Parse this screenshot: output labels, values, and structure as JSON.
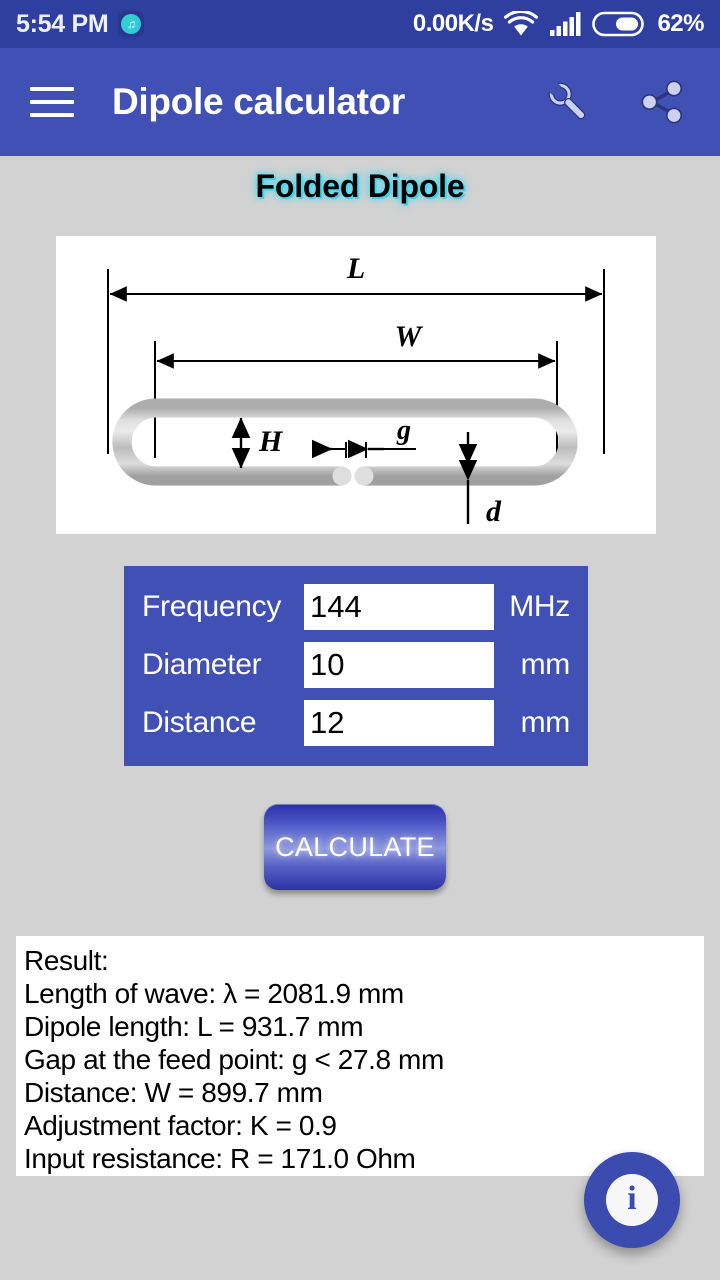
{
  "status_bar": {
    "time": "5:54 PM",
    "notification_icon": "app-notification-icon",
    "network_speed": "0.00K/s",
    "wifi_icon": "wifi-icon",
    "signal_icon": "cellular-signal-icon",
    "battery_icon": "battery-icon",
    "battery_percent": "62%",
    "background_color": "#2f3fa0"
  },
  "app_bar": {
    "menu_icon": "hamburger-menu-icon",
    "title": "Dipole calculator",
    "settings_icon": "wrench-icon",
    "share_icon": "share-icon",
    "background_color": "#4050b5"
  },
  "page": {
    "title": "Folded Dipole",
    "title_glow_color": "#4ad9ef",
    "background_color": "#d2d2d2"
  },
  "diagram": {
    "name": "folded-dipole-diagram",
    "labels": {
      "total_length": "L",
      "inner_width": "W",
      "height": "H",
      "gap": "g",
      "conductor_diameter": "d"
    }
  },
  "form": {
    "background_color": "#4050b5",
    "fields": [
      {
        "label": "Frequency",
        "value": "144",
        "placeholder": "",
        "unit": "MHz",
        "name": "frequency"
      },
      {
        "label": "Diameter",
        "value": "10",
        "placeholder": "",
        "unit": "mm",
        "name": "diameter"
      },
      {
        "label": "Distance",
        "value": "12",
        "placeholder": "",
        "unit": "mm",
        "name": "distance"
      }
    ]
  },
  "calculate_button": {
    "label": "CALCULATE"
  },
  "result": {
    "lines": [
      "Result:",
      "Length of wave: λ = 2081.9 mm",
      "Dipole length: L = 931.7 mm",
      "Gap at the feed point: g < 27.8 mm",
      "Distance: W = 899.7 mm",
      "Adjustment factor: K = 0.9",
      "Input resistance: R = 171.0 Ohm"
    ]
  },
  "fab": {
    "icon": "info-icon",
    "label": "i",
    "color": "#3b4bb0"
  }
}
